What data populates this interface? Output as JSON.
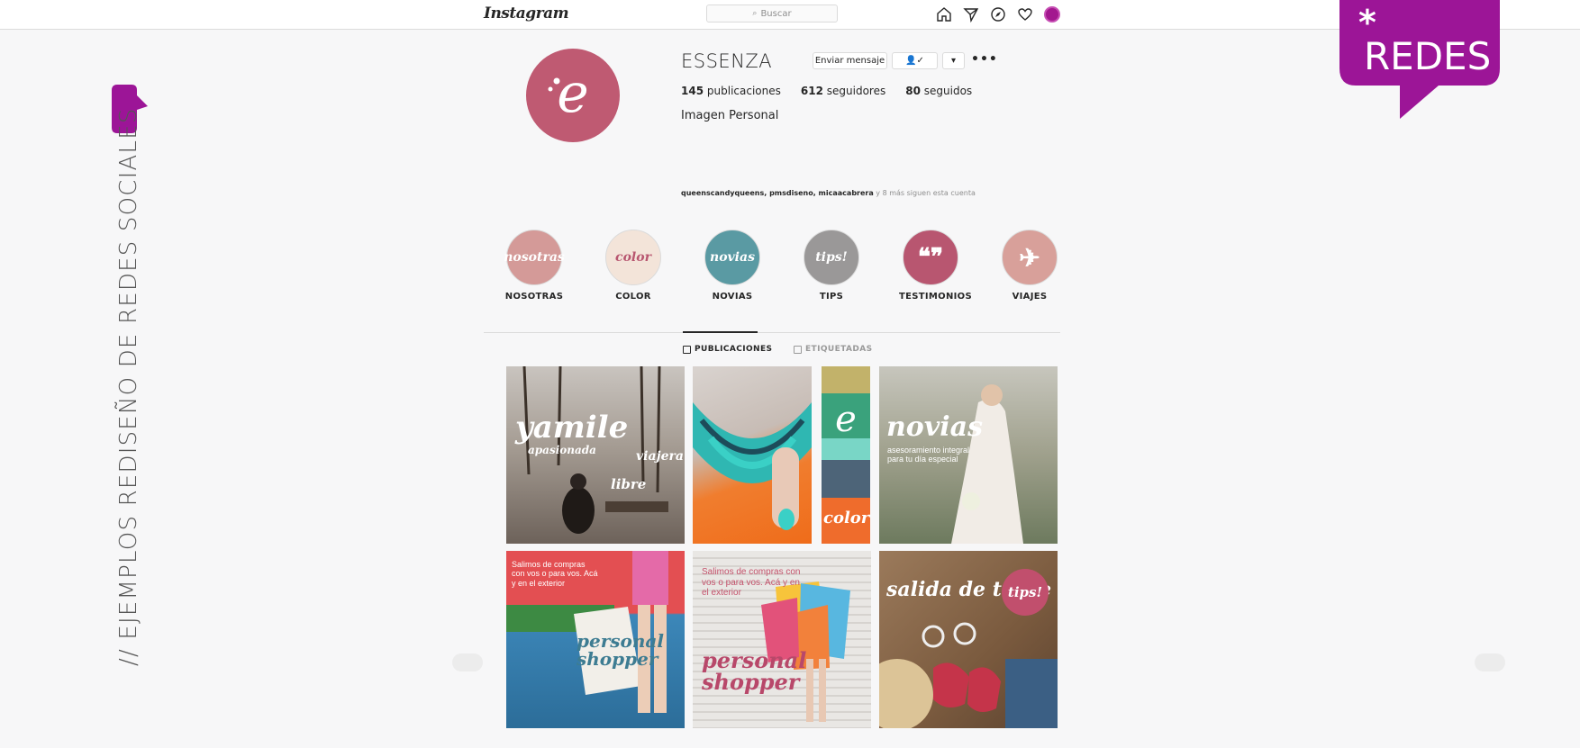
{
  "topbar": {
    "logo_text": "Instagram",
    "search_placeholder": "Buscar",
    "icons": [
      "home-icon",
      "direct-icon",
      "explore-icon",
      "heart-icon",
      "profile-avatar"
    ]
  },
  "side_caption": "// EJEMPLOS REDISEÑO DE REDES SOCIALES",
  "badge": {
    "star": "*",
    "text": "REDES",
    "color": "#9c1597"
  },
  "profile": {
    "username": "ESSENZA",
    "send_message_label": "Enviar mensaje",
    "stats": [
      {
        "count": "145",
        "label": "publicaciones"
      },
      {
        "count": "612",
        "label": "seguidores"
      },
      {
        "count": "80",
        "label": "seguidos"
      }
    ],
    "bio": "Imagen Personal",
    "followed_by_names": "queenscandyqueens, pmsdiseno, micaacabrera",
    "followed_by_rest": " y 8 más siguen esta cuenta",
    "avatar_color": "#bf5a72"
  },
  "highlights": [
    {
      "label": "NOSOTRAS",
      "art": "nosotras",
      "color": "#d49a98"
    },
    {
      "label": "COLOR",
      "art": "color",
      "color": "#f3e4d9"
    },
    {
      "label": "NOVIAS",
      "art": "novias",
      "color": "#5a9aa3"
    },
    {
      "label": "TIPS",
      "art": "tips!",
      "color": "#9a9898"
    },
    {
      "label": "TESTIMONIOS",
      "art": "❝❞",
      "color": "#b85670"
    },
    {
      "label": "VIAJES",
      "art": "✈",
      "color": "#d8a09a"
    }
  ],
  "tabs": [
    {
      "label": "PUBLICACIONES",
      "active": true
    },
    {
      "label": "ETIQUETADAS",
      "active": false
    }
  ],
  "posts": {
    "p1": {
      "script": "yamile",
      "sub1": "apasionada",
      "sub2": "viajera",
      "sub3": "libre"
    },
    "p3": {
      "script": "color"
    },
    "p4": {
      "script": "novias",
      "small": "asesoramiento integral para tu día especial"
    },
    "p5": {
      "small": "Salimos de compras con vos o para vos. Acá y en el exterior",
      "script": "personal shopper"
    },
    "p6": {
      "small": "Salimos de compras con vos o para vos. Acá y en el exterior",
      "script": "personal shopper"
    },
    "p7": {
      "script": "salida de tarde",
      "badge": "tips!"
    }
  }
}
